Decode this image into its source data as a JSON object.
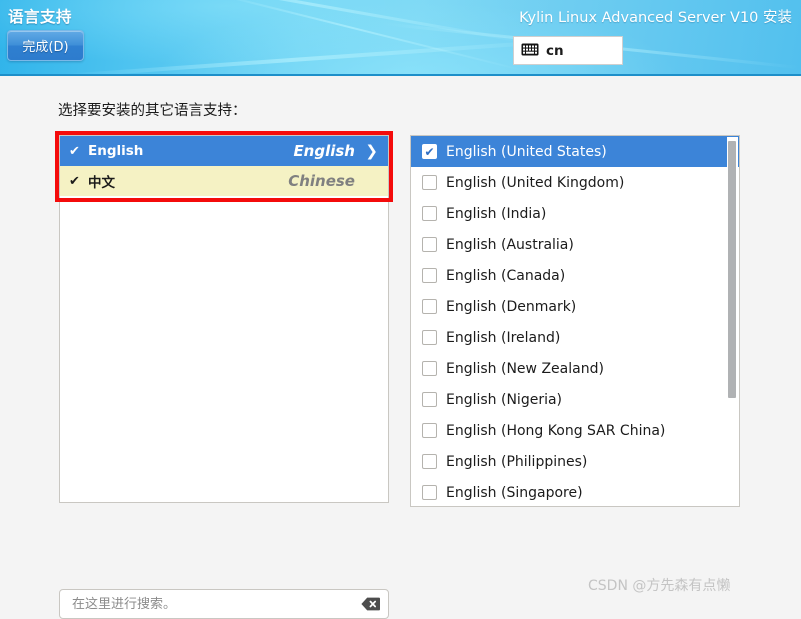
{
  "header": {
    "title": "语言支持",
    "done_label": "完成(D)",
    "product_title": "Kylin Linux Advanced Server V10 安装",
    "keyboard_layout": "cn",
    "keyboard_icon": "keyboard-icon",
    "accent_blue": "#2fb3ea",
    "button_blue": "#3f8fd8"
  },
  "main": {
    "instruction": "选择要安装的其它语言支持：",
    "highlight_color": "#f40b0b",
    "selection_blue": "#3c84d8",
    "marked_yellow": "#f5f2c4",
    "languages": [
      {
        "native": "English",
        "english": "English",
        "check": "✔",
        "chevron": "❯",
        "state": "selected"
      },
      {
        "native": "中文",
        "english": "Chinese",
        "check": "✔",
        "chevron": "❯",
        "state": "marked"
      }
    ],
    "search": {
      "placeholder": "在这里进行搜索。",
      "value": "",
      "clear_icon": "clear-backspace-icon"
    },
    "locales": [
      {
        "label": "English (United States)",
        "checked": true,
        "selected": true
      },
      {
        "label": "English (United Kingdom)",
        "checked": false,
        "selected": false
      },
      {
        "label": "English (India)",
        "checked": false,
        "selected": false
      },
      {
        "label": "English (Australia)",
        "checked": false,
        "selected": false
      },
      {
        "label": "English (Canada)",
        "checked": false,
        "selected": false
      },
      {
        "label": "English (Denmark)",
        "checked": false,
        "selected": false
      },
      {
        "label": "English (Ireland)",
        "checked": false,
        "selected": false
      },
      {
        "label": "English (New Zealand)",
        "checked": false,
        "selected": false
      },
      {
        "label": "English (Nigeria)",
        "checked": false,
        "selected": false
      },
      {
        "label": "English (Hong Kong SAR China)",
        "checked": false,
        "selected": false
      },
      {
        "label": "English (Philippines)",
        "checked": false,
        "selected": false
      },
      {
        "label": "English (Singapore)",
        "checked": false,
        "selected": false
      }
    ],
    "checkbox_tick": "✔"
  },
  "watermark": "CSDN @方先森有点懒"
}
